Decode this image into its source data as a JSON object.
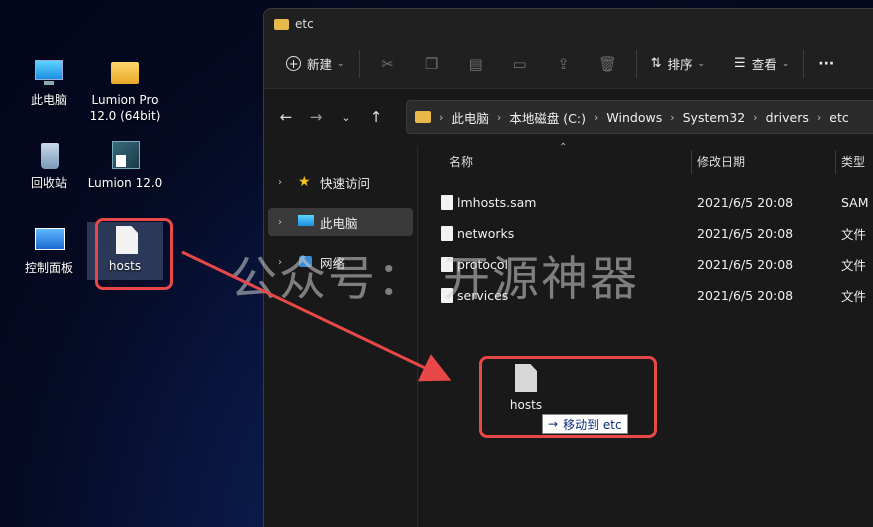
{
  "desktop": {
    "icons": [
      {
        "label": "此电脑",
        "icon": "computer-icon"
      },
      {
        "label": "Lumion Pro 12.0 (64bit)",
        "icon": "folder-icon"
      },
      {
        "label": "回收站",
        "icon": "recycle-bin-icon"
      },
      {
        "label": "Lumion 12.0",
        "icon": "lumion-icon"
      },
      {
        "label": "控制面板",
        "icon": "control-panel-icon"
      },
      {
        "label": "hosts",
        "icon": "file-icon"
      }
    ]
  },
  "window": {
    "title": "etc",
    "toolbar": {
      "new_label": "新建",
      "sort_label": "排序",
      "view_label": "查看",
      "more_label": "···"
    },
    "breadcrumb": [
      "此电脑",
      "本地磁盘 (C:)",
      "Windows",
      "System32",
      "drivers",
      "etc"
    ],
    "nav": [
      {
        "label": "快速访问",
        "icon": "star-icon"
      },
      {
        "label": "此电脑",
        "icon": "computer-icon"
      },
      {
        "label": "网络",
        "icon": "network-icon"
      }
    ],
    "columns": {
      "name": "名称",
      "date": "修改日期",
      "type": "类型"
    },
    "files": [
      {
        "name": "lmhosts.sam",
        "date": "2021/6/5 20:08",
        "type": "SAM"
      },
      {
        "name": "networks",
        "date": "2021/6/5 20:08",
        "type": "文件"
      },
      {
        "name": "protocol",
        "date": "2021/6/5 20:08",
        "type": "文件"
      },
      {
        "name": "services",
        "date": "2021/6/5 20:08",
        "type": "文件"
      }
    ]
  },
  "watermark": "公众号：  开源神器",
  "drag": {
    "file_label": "hosts",
    "tooltip_arrow": "→",
    "tooltip_text": "移动到 etc"
  },
  "colors": {
    "highlight": "#e84848",
    "folder": "#e8b84a",
    "selected_nav": "#3a3a3a"
  }
}
